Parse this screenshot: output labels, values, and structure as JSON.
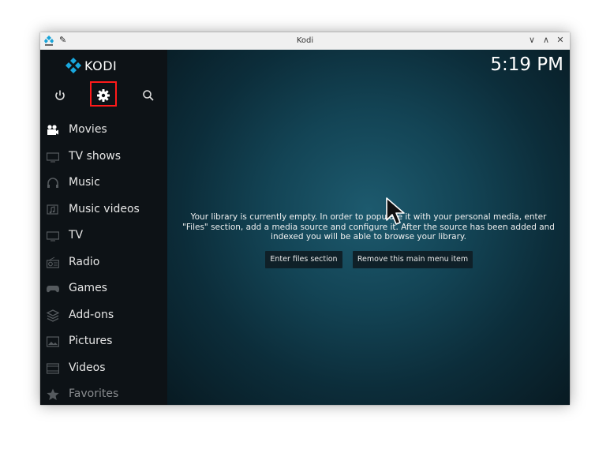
{
  "window": {
    "title": "Kodi"
  },
  "logo": {
    "brand": "KODI"
  },
  "header": {
    "clock": "5:19 PM"
  },
  "sidebar": {
    "items": [
      {
        "label": "Movies",
        "icon": "movies-icon"
      },
      {
        "label": "TV shows",
        "icon": "tv-shows-icon"
      },
      {
        "label": "Music",
        "icon": "music-icon"
      },
      {
        "label": "Music videos",
        "icon": "music-videos-icon"
      },
      {
        "label": "TV",
        "icon": "tv-icon"
      },
      {
        "label": "Radio",
        "icon": "radio-icon"
      },
      {
        "label": "Games",
        "icon": "games-icon"
      },
      {
        "label": "Add-ons",
        "icon": "addons-icon"
      },
      {
        "label": "Pictures",
        "icon": "pictures-icon"
      },
      {
        "label": "Videos",
        "icon": "videos-icon"
      },
      {
        "label": "Favorites",
        "icon": "favorites-icon"
      }
    ]
  },
  "main": {
    "message_line1": "Your library is currently empty. In order to populate it with your personal media, enter",
    "message_line2": "\"Files\" section, add a media source and configure it. After the source has been added and",
    "message_line3": "indexed you will be able to browse your library.",
    "enter_files_label": "Enter files section",
    "remove_item_label": "Remove this main menu item"
  },
  "colors": {
    "accent": "#12a0d7",
    "highlight_box": "#ff1a1a",
    "background": "#134455"
  }
}
